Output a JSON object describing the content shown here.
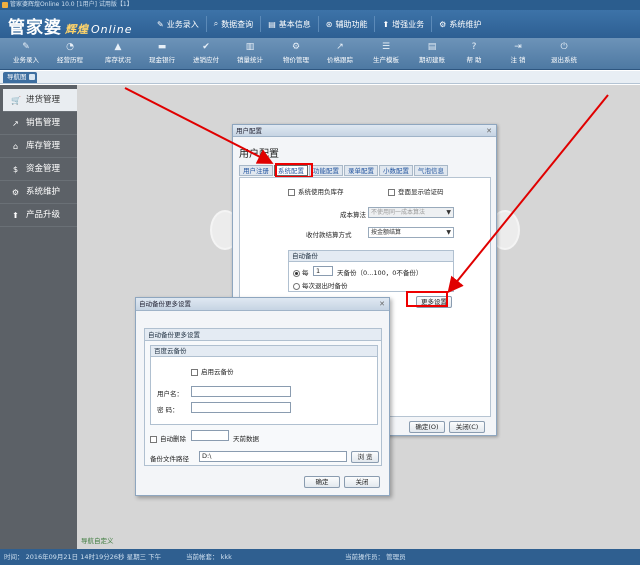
{
  "window": {
    "title": "管家婆辉煌Online 10.0 [1用户] 试用版【1】"
  },
  "brand": {
    "name": "管家婆",
    "edition": "辉煌",
    "online": "Online"
  },
  "top_menu": [
    {
      "label": "业务录入",
      "icon": "pencil-icon"
    },
    {
      "label": "数据查询",
      "icon": "search-icon"
    },
    {
      "label": "基本信息",
      "icon": "list-icon"
    },
    {
      "label": "辅助功能",
      "icon": "gear-icon"
    },
    {
      "label": "增强业务",
      "icon": "upload-icon"
    },
    {
      "label": "系统维护",
      "icon": "cog-icon"
    }
  ],
  "toolbar": [
    {
      "label": "业务录入",
      "glyph": "✎"
    },
    {
      "label": "经营历程",
      "glyph": "◔"
    },
    {
      "label": "库存状况",
      "glyph": "▲"
    },
    {
      "label": "现金银行",
      "glyph": "▬"
    },
    {
      "label": "进销应付",
      "glyph": "✔"
    },
    {
      "label": "销量统计",
      "glyph": "▥"
    },
    {
      "label": "物价管理",
      "glyph": "⚙"
    },
    {
      "label": "价格跟踪",
      "glyph": "↗"
    },
    {
      "label": "生产模板",
      "glyph": "☰"
    },
    {
      "label": "期初建账",
      "glyph": "▤"
    },
    {
      "label": "帮 助",
      "glyph": "?"
    },
    {
      "label": "注 销",
      "glyph": "⇥"
    },
    {
      "label": "退出系统",
      "glyph": "⏻"
    }
  ],
  "nav_tab": {
    "label": "导航图"
  },
  "sidebar": [
    {
      "label": "进货管理",
      "glyph": "🛒",
      "active": true
    },
    {
      "label": "销售管理",
      "glyph": "↗",
      "active": false
    },
    {
      "label": "库存管理",
      "glyph": "⌂",
      "active": false
    },
    {
      "label": "资金管理",
      "glyph": "$",
      "active": false
    },
    {
      "label": "系统维护",
      "glyph": "⚙",
      "active": false
    },
    {
      "label": "产品升级",
      "glyph": "⬆",
      "active": false
    }
  ],
  "nav_footer": "导航自定义",
  "status": {
    "datetime": "时间：  2016年09月21日 14时19分26秒 星期三 下午",
    "account": "当前帐套：  kkk",
    "operator": "当前操作员：  管理员"
  },
  "user_config": {
    "title": "用户配置",
    "heading": "用户配置",
    "tabs": [
      "用户注册",
      "系统配置",
      "功能配置",
      "录单配置",
      "小数配置",
      "气泡信息"
    ],
    "selected_tab": "系统配置",
    "allow_negative_stock": "系统使用负库存",
    "show_verify_code": "登面显示验证码",
    "cost_method_label": "成本算法",
    "cost_method_value": "不使用同一成本算法",
    "payment_settle_label": "收付款结算方式",
    "payment_settle_value": "按金额结算",
    "auto_backup": {
      "group_title": "自动备份",
      "every_prefix": "每",
      "every_value": "1",
      "every_suffix": "天备份（0...100，0不备份）",
      "on_exit": "每次退出时备份"
    },
    "more_settings": "更多设置",
    "ok": "确定(O)",
    "close": "关闭(C)"
  },
  "auto_backup_more": {
    "title": "自动备份更多设置",
    "section_title": "自动备份更多设置",
    "cloud_group_title": "百度云备份",
    "enable_cloud": "启用云备份",
    "username_label": "用户名：",
    "password_label": "密  码：",
    "username_value": "",
    "password_value": "",
    "auto_delete": "自动删除",
    "auto_delete_days": "",
    "auto_delete_suffix": "天前数据",
    "path_label": "备份文件路径",
    "path_value": "D:\\",
    "browse": "浏 览",
    "ok": "确定",
    "close": "关闭"
  },
  "colors": {
    "topbar": "#2d5f93",
    "sidebar": "#5c6167",
    "highlight_red": "#e00000",
    "link_blue": "#2456a0"
  }
}
